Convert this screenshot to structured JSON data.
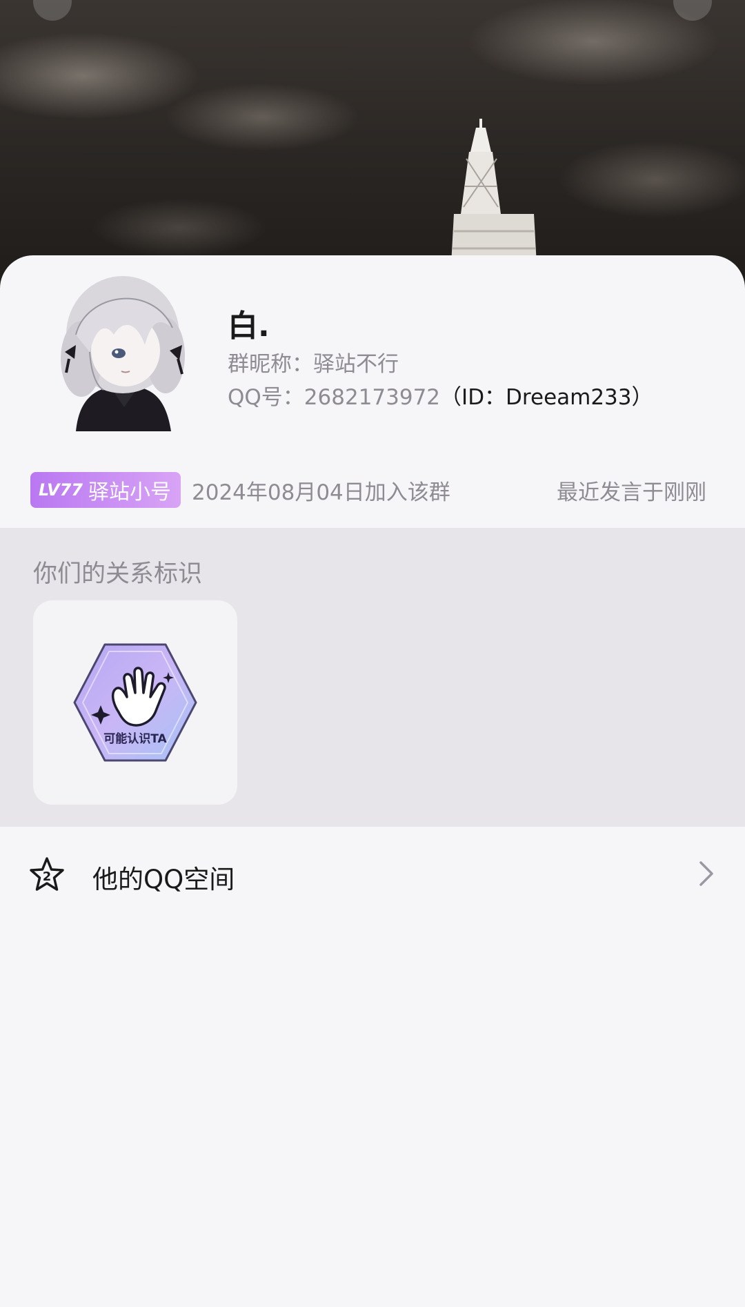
{
  "profile": {
    "nickname": "白.",
    "group_nickname": "群昵称：驿站不行",
    "qq_prefix": "QQ号：2682173972",
    "qq_id": "（ID：Dreeam233）"
  },
  "member": {
    "level_badge": "LV77",
    "title_badge": "驿站小号",
    "join_date": "2024年08月04日加入该群",
    "last_speak": "最近发言于刚刚"
  },
  "relation": {
    "section_title": "你们的关系标识",
    "tag_label": "可能认识TA"
  },
  "qzone": {
    "label": "他的QQ空间",
    "icon_number": "2"
  },
  "colors": {
    "badge_start": "#b978f2",
    "badge_end": "#d8a4f5",
    "card_bg": "#f6f5f8",
    "section_bg": "#e7e5ea",
    "secondary_text": "#8e8c92"
  }
}
